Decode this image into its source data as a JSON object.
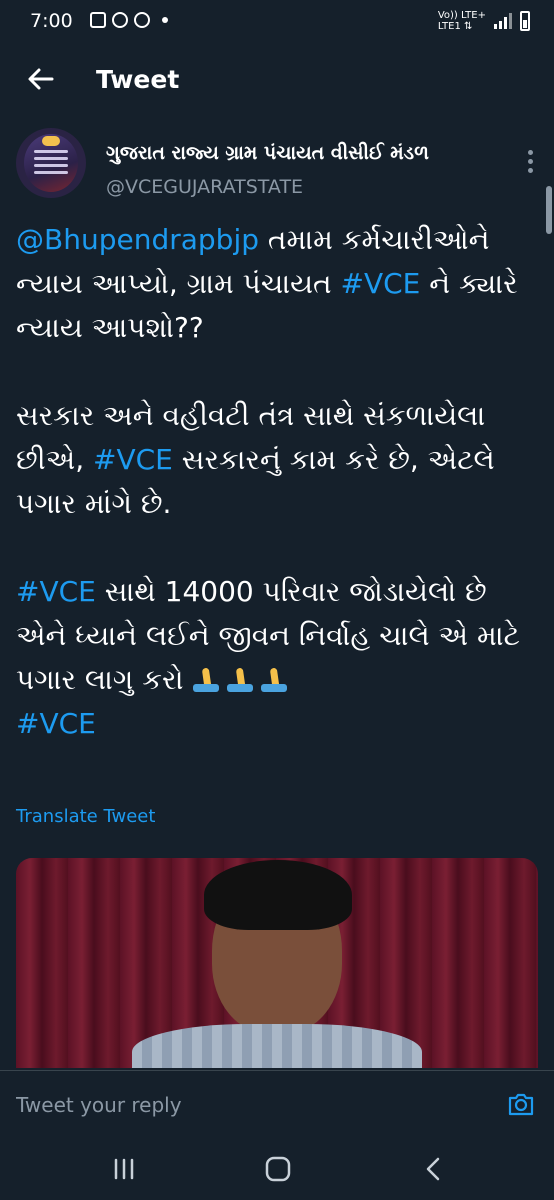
{
  "status_bar": {
    "time": "7:00",
    "network_line1": "Vo)) LTE+",
    "network_line2": "LTE1 ⇅"
  },
  "header": {
    "title": "Tweet"
  },
  "tweet": {
    "author_name": "ગુજરાત રાજ્ય ગ્રામ પંચાયત વીસીઈ મંડળ",
    "author_handle": "@VCEGUJARATSTATE",
    "para1": {
      "mention": "@Bhupendrapbjp",
      "text_a": " તમામ કર્મચારીઓને ન્યાય આપ્યો, ગ્રામ પંચાયત ",
      "hashtag": "#VCE",
      "text_b": " ને ક્યારે ન્યાય આપશો??"
    },
    "para2": {
      "text_a": "સરકાર અને વહીવટી તંત્ર સાથે સંકળાયેલા છીએ, ",
      "hashtag": "#VCE",
      "text_b": " સરકારનું કામ કરે છે, એટલે પગાર માંગે છે."
    },
    "para3": {
      "hashtag": "#VCE",
      "text_a": " સાથે 14000 પરિવાર જોડાયેલો છે એને ધ્યાને લઈને જીવન નિર્વાહ ચાલે એ માટે પગાર લાગુ કરો ",
      "final_hashtag": "#VCE"
    },
    "emoji": "praying-hands",
    "translate_label": "Translate Tweet"
  },
  "reply": {
    "placeholder": "Tweet your reply"
  },
  "colors": {
    "background": "#15202b",
    "link": "#1d9bf0",
    "secondary_text": "#8b98a5"
  },
  "icons": [
    "back-arrow-icon",
    "more-options-icon",
    "camera-icon",
    "recent-apps-icon",
    "home-icon",
    "nav-back-icon"
  ]
}
